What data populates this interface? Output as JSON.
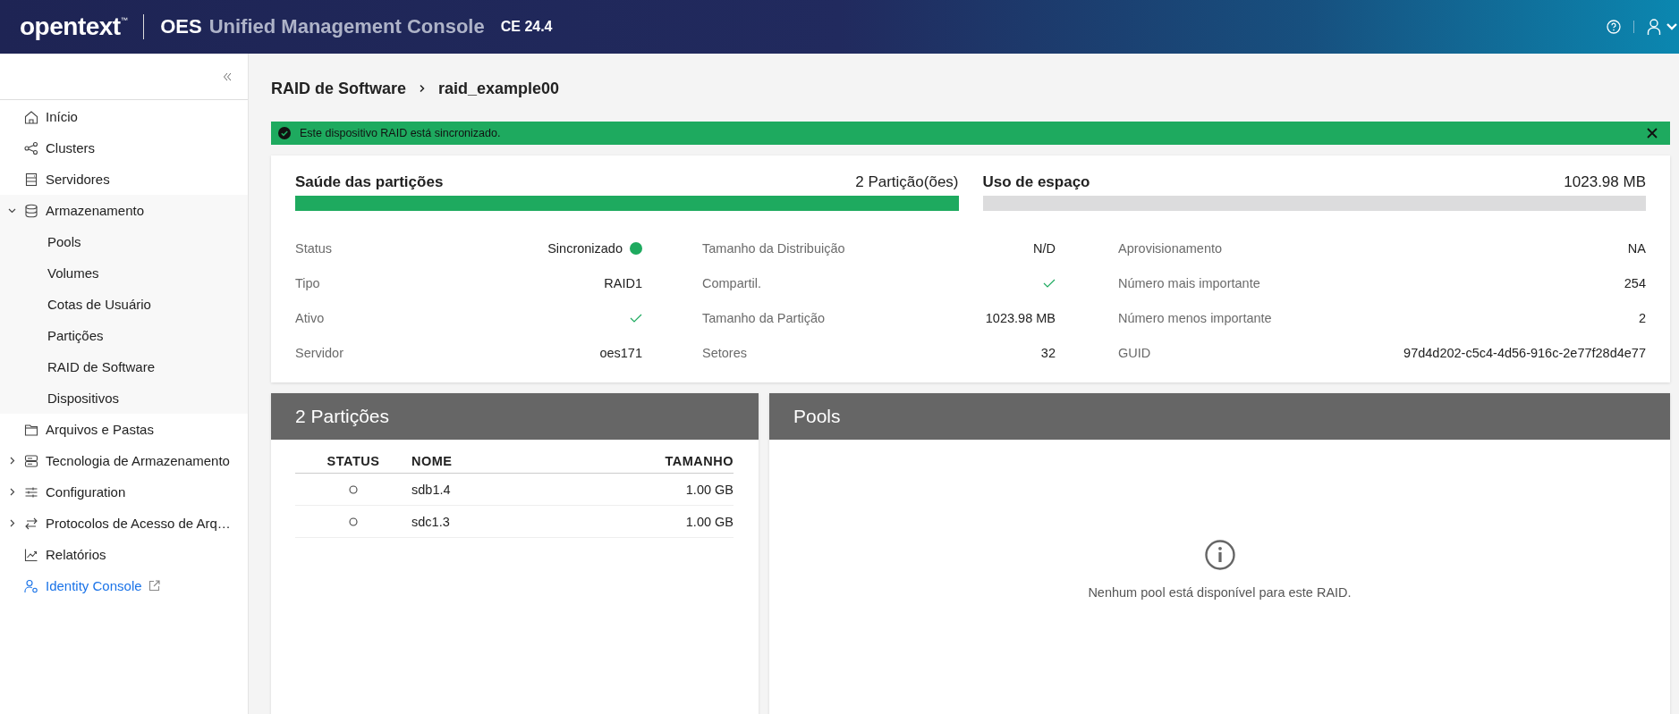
{
  "header": {
    "brand": "opentext",
    "trademark": "™",
    "product": "OES",
    "title": "Unified Management Console",
    "version": "CE 24.4"
  },
  "sidebar": {
    "items": [
      {
        "label": "Início",
        "kind": "item"
      },
      {
        "label": "Clusters",
        "kind": "item"
      },
      {
        "label": "Servidores",
        "kind": "item"
      },
      {
        "label": "Armazenamento",
        "kind": "group",
        "expanded": true,
        "children": [
          {
            "label": "Pools"
          },
          {
            "label": "Volumes"
          },
          {
            "label": "Cotas de Usuário"
          },
          {
            "label": "Partições"
          },
          {
            "label": "RAID de Software"
          },
          {
            "label": "Dispositivos"
          }
        ]
      },
      {
        "label": "Arquivos e Pastas",
        "kind": "item"
      },
      {
        "label": "Tecnologia de Armazenamento",
        "kind": "group",
        "expanded": false
      },
      {
        "label": "Configuration",
        "kind": "group",
        "expanded": false
      },
      {
        "label": "Protocolos de Acesso de Arq…",
        "kind": "group",
        "expanded": false
      },
      {
        "label": "Relatórios",
        "kind": "item"
      },
      {
        "label": "Identity Console",
        "kind": "link"
      }
    ]
  },
  "breadcrumb": [
    "RAID de Software",
    "raid_example00"
  ],
  "banner": {
    "message": "Este dispositivo RAID está sincronizado."
  },
  "summary": {
    "health": {
      "title": "Saúde das partições",
      "value": "2 Partição(ões)",
      "level": 1
    },
    "space": {
      "title": "Uso de espaço",
      "value": "1023.98 MB",
      "level": 0
    },
    "columns": [
      [
        {
          "label": "Status",
          "kind": "status",
          "value": "Sincronizado",
          "color": "#1eaa5f"
        },
        {
          "label": "Tipo",
          "kind": "text",
          "value": "RAID1"
        },
        {
          "label": "Ativo",
          "kind": "check",
          "checked": true
        },
        {
          "label": "Servidor",
          "kind": "text",
          "value": "oes171"
        }
      ],
      [
        {
          "label": "Tamanho da Distribuição",
          "kind": "text",
          "value": "N/D"
        },
        {
          "label": "Compartil.",
          "kind": "check",
          "checked": true
        },
        {
          "label": "Tamanho da Partição",
          "kind": "text",
          "value": "1023.98 MB"
        },
        {
          "label": "Setores",
          "kind": "text",
          "value": "32"
        }
      ],
      [
        {
          "label": "Aprovisionamento",
          "kind": "text",
          "value": "NA"
        },
        {
          "label": "Número mais importante",
          "kind": "text",
          "value": "254"
        },
        {
          "label": "Número menos importante",
          "kind": "text",
          "value": "2"
        },
        {
          "label": "GUID",
          "kind": "text",
          "value": "97d4d202-c5c4-4d56-916c-2e77f28d4e77"
        }
      ]
    ]
  },
  "partitions": {
    "title": "2 Partições",
    "columns": [
      "STATUS",
      "NOME",
      "TAMANHO"
    ],
    "rows": [
      {
        "name": "sdb1.4",
        "size": "1.00 GB"
      },
      {
        "name": "sdc1.3",
        "size": "1.00 GB"
      }
    ]
  },
  "pools": {
    "title": "Pools",
    "empty_message": "Nenhum pool está disponível para este RAID."
  }
}
